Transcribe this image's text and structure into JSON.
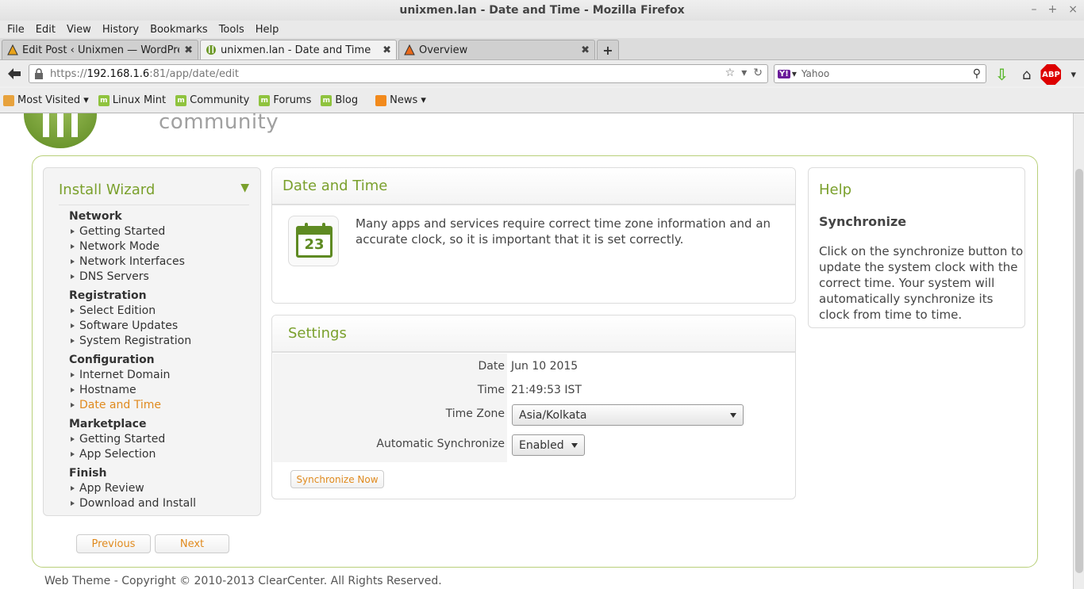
{
  "window": {
    "title": "unixmen.lan - Date and Time - Mozilla Firefox",
    "controls": [
      "–",
      "+",
      "×"
    ]
  },
  "menu": [
    "File",
    "Edit",
    "View",
    "History",
    "Bookmarks",
    "Tools",
    "Help"
  ],
  "tabs": [
    {
      "label": "Edit Post ‹ Unixmen — WordPress"
    },
    {
      "label": "unixmen.lan - Date and Time"
    },
    {
      "label": "Overview"
    }
  ],
  "url": {
    "scheme": "https://",
    "host": "192.168.1.6",
    "rest": ":81/app/date/edit"
  },
  "search": {
    "placeholder": "Yahoo",
    "engine_badge": "Y!"
  },
  "abp_label": "ABP",
  "bookmarks": [
    "Most Visited",
    "Linux Mint",
    "Community",
    "Forums",
    "Blog",
    "News"
  ],
  "logo_text": "community",
  "wizard": {
    "title": "Install Wizard",
    "groups": [
      {
        "name": "Network",
        "items": [
          "Getting Started",
          "Network Mode",
          "Network Interfaces",
          "DNS Servers"
        ]
      },
      {
        "name": "Registration",
        "items": [
          "Select Edition",
          "Software Updates",
          "System Registration"
        ]
      },
      {
        "name": "Configuration",
        "items": [
          "Internet Domain",
          "Hostname",
          "Date and Time"
        ]
      },
      {
        "name": "Marketplace",
        "items": [
          "Getting Started",
          "App Selection"
        ]
      },
      {
        "name": "Finish",
        "items": [
          "App Review",
          "Download and Install"
        ]
      }
    ],
    "current": "Date and Time",
    "previous_label": "Previous",
    "next_label": "Next"
  },
  "date_panel": {
    "title": "Date and Time",
    "calendar_number": "23",
    "intro": "Many apps and services require correct time zone information and an accurate clock, so it is important that it is set correctly."
  },
  "settings": {
    "title": "Settings",
    "date_label": "Date",
    "date_value": "Jun 10 2015",
    "time_label": "Time",
    "time_value": "21:49:53 IST",
    "timezone_label": "Time Zone",
    "timezone_value": "Asia/Kolkata",
    "autosync_label": "Automatic Synchronize",
    "autosync_value": "Enabled",
    "sync_button": "Synchronize Now"
  },
  "help": {
    "title": "Help",
    "subtitle": "Synchronize",
    "text": "Click on the synchronize button to update the system clock with the correct time. Your system will automatically synchronize its clock from time to time."
  },
  "footer": "Web Theme - Copyright © 2010-2013 ClearCenter. All Rights Reserved."
}
